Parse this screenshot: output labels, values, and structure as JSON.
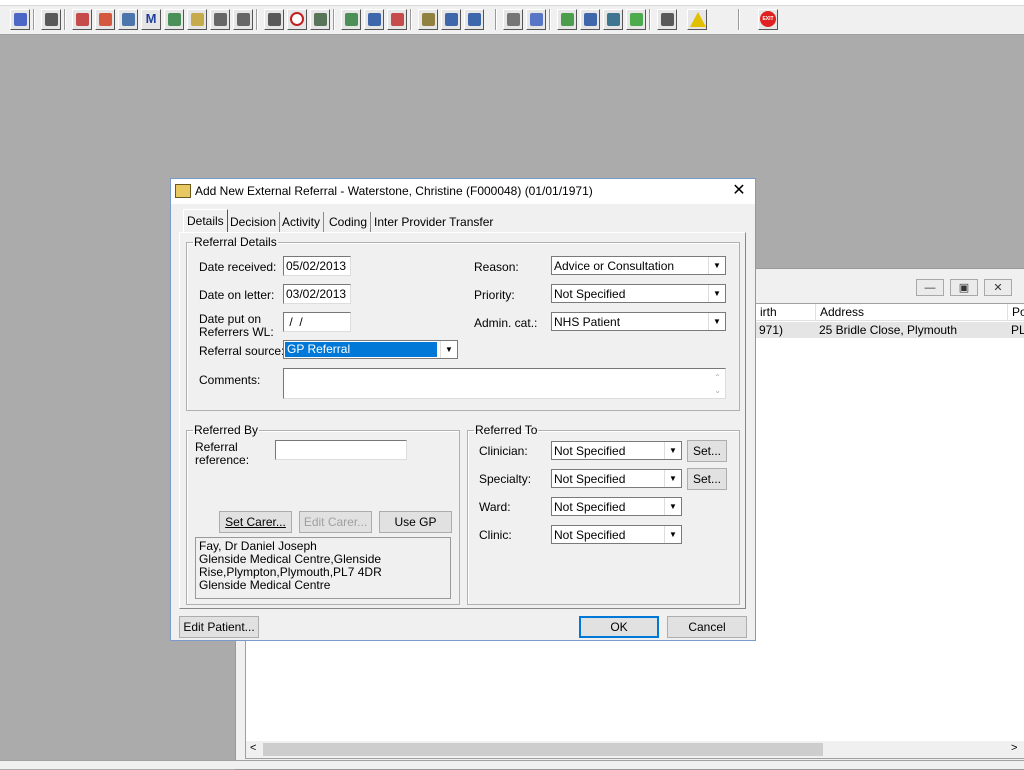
{
  "toolbar": {
    "icons": [
      "users-icon",
      "printer-icon",
      "book-icon",
      "folder-edit-icon",
      "document-grid-icon",
      "m-icon",
      "person-icon",
      "notepad-icon",
      "card-icon",
      "card-icon",
      "search-doc-icon",
      "clock-icon",
      "monitor-icon",
      "chart-icon",
      "screen-icon",
      "dial-icon",
      "list-icon",
      "bed-icon",
      "tray-icon",
      "page-icon",
      "bar-chart-icon",
      "globe-icon",
      "checklist-icon",
      "download-icon",
      "checklist-green-icon",
      "transfer-icon",
      "warning-icon",
      "exit-icon"
    ],
    "exit_label": "EXIT"
  },
  "background_window": {
    "columns": [
      "irth",
      "Address",
      "Po"
    ],
    "row": [
      "971)",
      "25 Bridle Close, Plymouth",
      "PL"
    ]
  },
  "dialog": {
    "title": "Add New External Referral - Waterstone, Christine (F000048) (01/01/1971)",
    "close": "✕",
    "tabs": [
      "Details",
      "Decision",
      "Activity",
      "Coding",
      "Inter Provider Transfer"
    ],
    "referral_details": {
      "legend": "Referral Details",
      "date_received_label": "Date received:",
      "date_received": "05/02/2013",
      "date_on_letter_label": "Date on letter:",
      "date_on_letter": "03/02/2013",
      "date_put_on_wl_label_1": "Date put on",
      "date_put_on_wl_label_2": "Referrers WL:",
      "date_put_on_wl": " /  /",
      "referral_source_label": "Referral source:",
      "referral_source": "GP Referral",
      "reason_label": "Reason:",
      "reason": "Advice or Consultation",
      "priority_label": "Priority:",
      "priority": "Not Specified",
      "admin_cat_label": "Admin. cat.:",
      "admin_cat": "NHS Patient",
      "comments_label": "Comments:"
    },
    "referred_by": {
      "legend": "Referred By",
      "reference_label_1": "Referral",
      "reference_label_2": "reference:",
      "set_carer": "Set Carer...",
      "edit_carer": "Edit Carer...",
      "use_gp": "Use GP",
      "gp_lines": [
        "Fay, Dr Daniel Joseph",
        "Glenside Medical Centre,Glenside",
        "Rise,Plympton,Plymouth,PL7 4DR",
        "Glenside Medical Centre"
      ]
    },
    "referred_to": {
      "legend": "Referred To",
      "clinician_label": "Clinician:",
      "clinician": "Not Specified",
      "specialty_label": "Specialty:",
      "specialty": "Not Specified",
      "ward_label": "Ward:",
      "ward": "Not Specified",
      "clinic_label": "Clinic:",
      "clinic": "Not Specified",
      "set_label": "Set..."
    },
    "buttons": {
      "edit_patient": "Edit Patient...",
      "ok": "OK",
      "cancel": "Cancel"
    }
  }
}
